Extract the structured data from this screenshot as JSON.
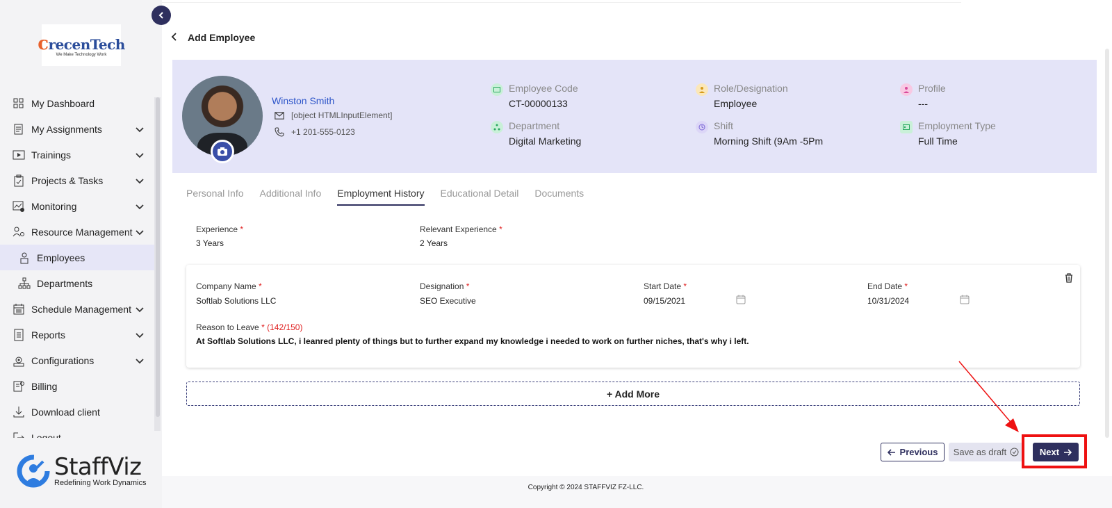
{
  "sidebar": {
    "logo_main": "recenTech",
    "logo_tagline": "We Make Technology Work",
    "items": [
      {
        "label": "My Dashboard",
        "icon": "dashboard-icon",
        "expandable": false
      },
      {
        "label": "My Assignments",
        "icon": "assignments-icon",
        "expandable": true
      },
      {
        "label": "Trainings",
        "icon": "trainings-icon",
        "expandable": true
      },
      {
        "label": "Projects & Tasks",
        "icon": "clipboard-icon",
        "expandable": true
      },
      {
        "label": "Monitoring",
        "icon": "monitoring-icon",
        "expandable": true
      },
      {
        "label": "Resource Management",
        "icon": "people-gear-icon",
        "expandable": true
      },
      {
        "label": "Employees",
        "icon": "employee-icon",
        "expandable": false,
        "active": true,
        "sub": true
      },
      {
        "label": "Departments",
        "icon": "org-chart-icon",
        "expandable": false,
        "sub": true
      },
      {
        "label": "Schedule Management",
        "icon": "calendar-icon",
        "expandable": true
      },
      {
        "label": "Reports",
        "icon": "reports-icon",
        "expandable": true
      },
      {
        "label": "Configurations",
        "icon": "config-icon",
        "expandable": true
      },
      {
        "label": "Billing",
        "icon": "billing-icon",
        "expandable": false
      },
      {
        "label": "Download client",
        "icon": "download-icon",
        "expandable": false
      },
      {
        "label": "Logout",
        "icon": "logout-icon",
        "expandable": false
      }
    ],
    "brand_name": "StaffViz",
    "brand_tagline": "Redefining Work Dynamics"
  },
  "header": {
    "title": "Add Employee"
  },
  "profile": {
    "name": "Winston Smith",
    "email": "[object HTMLInputElement]",
    "phone": "+1 201-555-0123",
    "fields": {
      "employee_code": {
        "label": "Employee Code",
        "value": "CT-00000133"
      },
      "role": {
        "label": "Role/Designation",
        "value": "Employee"
      },
      "profile": {
        "label": "Profile",
        "value": "---"
      },
      "department": {
        "label": "Department",
        "value": "Digital Marketing"
      },
      "shift": {
        "label": "Shift",
        "value": "Morning Shift (9Am -5Pm"
      },
      "employment_type": {
        "label": "Employment Type",
        "value": "Full Time"
      }
    }
  },
  "tabs": [
    "Personal Info",
    "Additional Info",
    "Employment History",
    "Educational Detail",
    "Documents"
  ],
  "active_tab": "Employment History",
  "experience": {
    "label": "Experience",
    "value": "3 Years",
    "relevant_label": "Relevant Experience",
    "relevant_value": "2 Years"
  },
  "job": {
    "company_label": "Company Name",
    "company": "Softlab Solutions LLC",
    "designation_label": "Designation",
    "designation": "SEO Executive",
    "start_label": "Start Date",
    "start": "09/15/2021",
    "end_label": "End Date",
    "end": "10/31/2024",
    "reason_label": "Reason to Leave",
    "reason_count": "(142/150)",
    "reason": "At Softlab Solutions LLC, i leanred plenty of things but to further expand my knowledge i needed to work on further niches, that's why i left."
  },
  "required_mark": "*",
  "actions": {
    "add_more": "+ Add More",
    "previous": "Previous",
    "save_draft": "Save as draft",
    "next": "Next"
  },
  "footer": "Copyright © 2024 STAFFVIZ FZ-LLC.",
  "colors": {
    "primary": "#2e2f5e",
    "profile_bg": "#e4e4f8",
    "link": "#2d55c9",
    "required": "#e02020",
    "annotation": "#ee1111"
  }
}
